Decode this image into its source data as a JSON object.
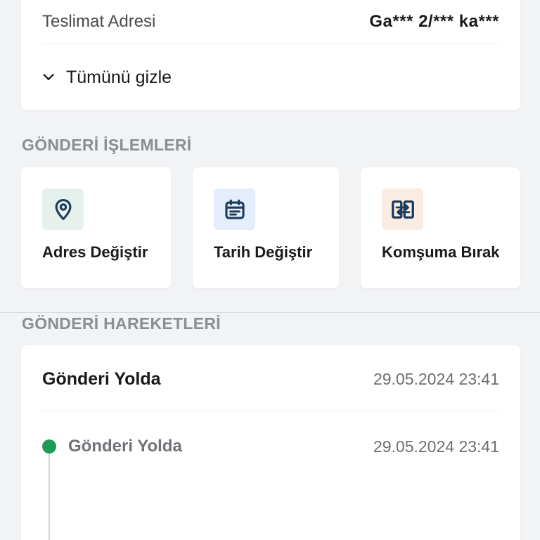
{
  "address_card": {
    "label": "Teslimat Adresi",
    "value": "Ga*** 2/*** ka***",
    "toggle_label": "Tümünü gizle",
    "toggle_icon": "chevron-down-icon"
  },
  "operations": {
    "title": "GÖNDERİ İŞLEMLERİ",
    "actions": [
      {
        "label": "Adres Değiştir",
        "icon": "location-pin-icon",
        "icon_bg": "#e6f1ec"
      },
      {
        "label": "Tarih Değiştir",
        "icon": "calendar-icon",
        "icon_bg": "#e3edfb"
      },
      {
        "label": "Komşuma Bırak",
        "icon": "neighbor-swap-icon",
        "icon_bg": "#f9ece2"
      }
    ]
  },
  "movements": {
    "title": "GÖNDERİ HAREKETLERİ",
    "current_status": "Gönderi Yolda",
    "current_date": "29.05.2024 23:41",
    "timeline": [
      {
        "status": "Gönderi Yolda",
        "date": "29.05.2024 23:41",
        "dot_color": "#1f9a57"
      }
    ]
  },
  "colors": {
    "icon_dark": "#1c3a5c",
    "success": "#1f9a57",
    "background": "#f2f3f5"
  }
}
